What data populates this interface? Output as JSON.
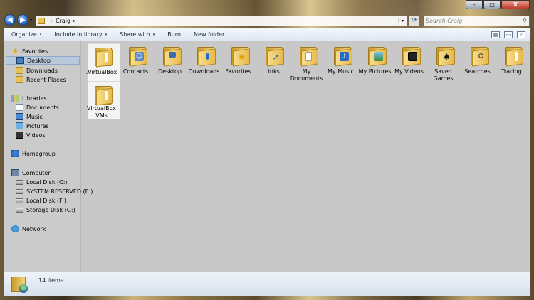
{
  "window": {
    "caption": {
      "minimize": "–",
      "maximize": "□",
      "close": "X"
    }
  },
  "nav": {
    "back_icon": "◀",
    "forward_icon": "▶",
    "dropdown": "▾"
  },
  "address": {
    "crumb_arrow": "▸",
    "path": "Craig",
    "trail_arrow": "▸",
    "dropdown": "▾",
    "refresh_icon": "⟳"
  },
  "search": {
    "placeholder": "Search Craig",
    "icon": "⚲"
  },
  "toolbar": {
    "items": [
      "Organize",
      "Include in library",
      "Share with",
      "Burn",
      "New folder"
    ],
    "dropdown": "▾",
    "view_icon": "▦",
    "preview_icon": "▭",
    "help_icon": "?"
  },
  "navpane": {
    "favorites": "Favorites",
    "desktop": "Desktop",
    "downloads": "Downloads",
    "recent": "Recent Places",
    "libraries": "Libraries",
    "documents": "Documents",
    "music": "Music",
    "pictures": "Pictures",
    "videos": "Videos",
    "homegroup": "Homegroup",
    "computer": "Computer",
    "disk_c": "Local Disk (C:)",
    "disk_e": "SYSTEM RESERVED (E:)",
    "disk_f": "Local Disk (F:)",
    "disk_g": "Storage Disk (G:)",
    "network": "Network"
  },
  "files": [
    {
      "line1": ".VirtualBox",
      "line2": ""
    },
    {
      "line1": "Contacts",
      "line2": ""
    },
    {
      "line1": "Desktop",
      "line2": ""
    },
    {
      "line1": "Downloads",
      "line2": ""
    },
    {
      "line1": "Favorites",
      "line2": ""
    },
    {
      "line1": "Links",
      "line2": ""
    },
    {
      "line1": "My",
      "line2": "Documents"
    },
    {
      "line1": "My Music",
      "line2": ""
    },
    {
      "line1": "My Pictures",
      "line2": ""
    },
    {
      "line1": "My Videos",
      "line2": ""
    },
    {
      "line1": "Saved",
      "line2": "Games"
    },
    {
      "line1": "Searches",
      "line2": ""
    },
    {
      "line1": "Tracing",
      "line2": ""
    },
    {
      "line1": "VirtualBox",
      "line2": "VMs"
    }
  ],
  "status": {
    "count": "14 items"
  }
}
